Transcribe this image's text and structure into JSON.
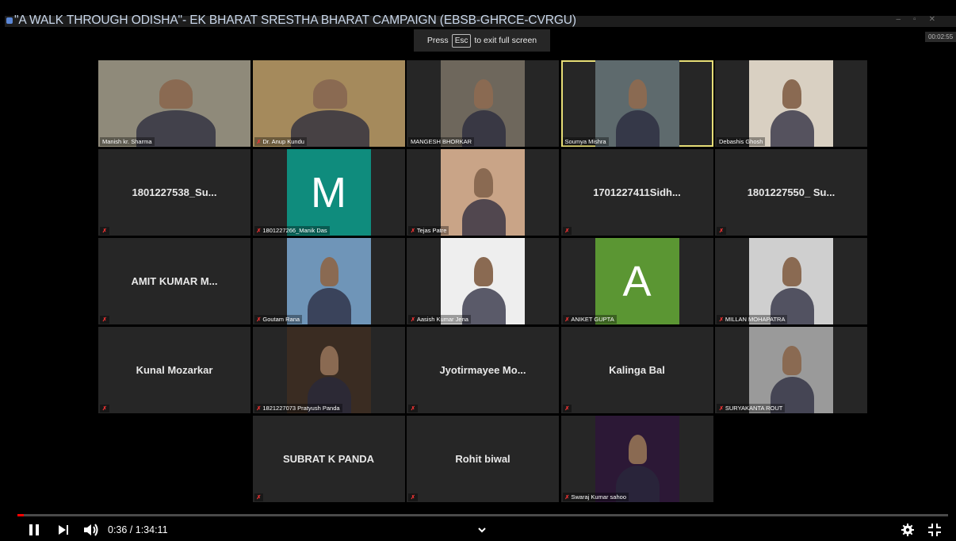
{
  "window": {
    "title": "\"A WALK THROUGH ODISHA\"- EK BHARAT SRESTHA BHARAT CAMPAIGN (EBSB-GHRCE-CVRGU)"
  },
  "fullscreen_hint": {
    "press": "Press",
    "key": "Esc",
    "rest": "to exit full screen"
  },
  "meeting_timer": "00:02:55",
  "participants": [
    {
      "label": "Manish kr. Sharma",
      "kind": "video",
      "bg": "#8f8a7a",
      "muted": false
    },
    {
      "label": "Dr. Anup Kundu",
      "kind": "video",
      "bg": "#a58a5c",
      "muted": true
    },
    {
      "label": "MANGESH BHORKAR",
      "kind": "video",
      "bg": "#6e675c",
      "muted": false
    },
    {
      "label": "Soumya Mishra",
      "kind": "video",
      "bg": "#5e6a6d",
      "muted": false,
      "active": true
    },
    {
      "label": "Debashis Ghosh",
      "kind": "video",
      "bg": "#d9d0c2",
      "muted": false
    },
    {
      "name": "1801227538_Su...",
      "kind": "name",
      "muted": true
    },
    {
      "label": "1801227266_Manik Das",
      "kind": "avatar",
      "letter": "M",
      "color": "#0f8c7d",
      "muted": true
    },
    {
      "label": "Tejas Patre",
      "kind": "video",
      "bg": "#c9a487",
      "muted": true
    },
    {
      "name": "1701227411Sidh...",
      "kind": "name",
      "muted": true
    },
    {
      "name": "1801227550_ Su...",
      "kind": "name",
      "muted": true
    },
    {
      "name": "AMIT KUMAR M...",
      "kind": "name",
      "muted": true
    },
    {
      "label": "Goutam Rana",
      "kind": "video",
      "bg": "#6f95b8",
      "muted": true
    },
    {
      "label": "Aasish Kumar Jena",
      "kind": "video",
      "bg": "#eeeeee",
      "muted": true
    },
    {
      "label": "ANIKET GUPTA",
      "kind": "avatar",
      "letter": "A",
      "color": "#5b9633",
      "muted": true
    },
    {
      "label": "MILLAN MOHAPATRA",
      "kind": "video",
      "bg": "#cfcfcf",
      "muted": true
    },
    {
      "name": "Kunal Mozarkar",
      "kind": "name",
      "muted": true
    },
    {
      "label": "1821227073 Pratyush Panda",
      "kind": "video",
      "bg": "#3a2c22",
      "muted": true
    },
    {
      "name": "Jyotirmayee  Mo...",
      "kind": "name",
      "muted": true
    },
    {
      "name": "Kalinga Bal",
      "kind": "name",
      "muted": true
    },
    {
      "label": "SURYAKANTA ROUT",
      "kind": "video",
      "bg": "#9a9a9a",
      "muted": true
    },
    {
      "name": "SUBRAT K PANDA",
      "kind": "name",
      "muted": true
    },
    {
      "name": "Rohit biwal",
      "kind": "name",
      "muted": true
    },
    {
      "label": "Swaraj Kumar sahoo",
      "kind": "video",
      "bg": "#2c1836",
      "muted": true
    }
  ],
  "player": {
    "current_time": "0:36",
    "separator": "/",
    "duration": "1:34:11",
    "time_display": "0:36 / 1:34:11",
    "progress": 0.0064,
    "icons": [
      "pause-icon",
      "next-icon",
      "volume-icon",
      "chevron-down-icon",
      "settings-icon",
      "exit-fullscreen-icon"
    ]
  }
}
